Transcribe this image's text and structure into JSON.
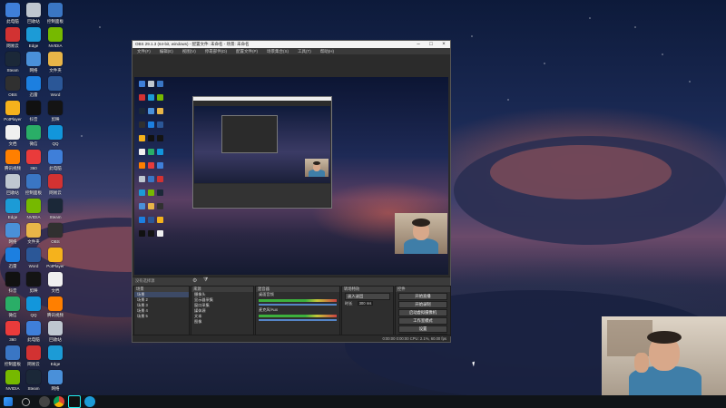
{
  "desktop": {
    "icons": [
      {
        "label": "此电脑",
        "color": "#3f7fd9",
        "icon": "computer-icon"
      },
      {
        "label": "回收站",
        "color": "#bfc7d0",
        "icon": "recycle-bin-icon"
      },
      {
        "label": "控制面板",
        "color": "#3a76c4",
        "icon": "control-panel-icon"
      },
      {
        "label": "网易云",
        "color": "#d23232",
        "icon": "netease-music-icon"
      },
      {
        "label": "Edge",
        "color": "#1c9bd6",
        "icon": "edge-icon"
      },
      {
        "label": "NVIDIA",
        "color": "#76b900",
        "icon": "nvidia-icon"
      },
      {
        "label": "Steam",
        "color": "#1b2838",
        "icon": "steam-icon"
      },
      {
        "label": "网络",
        "color": "#4a90d9",
        "icon": "network-icon"
      },
      {
        "label": "文件夹",
        "color": "#e8b548",
        "icon": "folder-icon"
      },
      {
        "label": "OBS",
        "color": "#303030",
        "icon": "obs-icon"
      },
      {
        "label": "迅雷",
        "color": "#1c7fe0",
        "icon": "thunder-icon"
      },
      {
        "label": "Word",
        "color": "#2b5797",
        "icon": "word-icon"
      },
      {
        "label": "PotPlayer",
        "color": "#f5b21c",
        "icon": "potplayer-icon"
      },
      {
        "label": "抖音",
        "color": "#111111",
        "icon": "douyin-icon"
      },
      {
        "label": "剪映",
        "color": "#141414",
        "icon": "capcut-icon"
      },
      {
        "label": "文档",
        "color": "#f0f0f0",
        "icon": "document-icon"
      },
      {
        "label": "微信",
        "color": "#2aae67",
        "icon": "wechat-icon"
      },
      {
        "label": "QQ",
        "color": "#1296db",
        "icon": "qq-icon"
      },
      {
        "label": "腾讯视频",
        "color": "#ff7f00",
        "icon": "tencent-video-icon"
      },
      {
        "label": "360",
        "color": "#e93b3b",
        "icon": "360-icon"
      }
    ]
  },
  "taskbar": {
    "items": [
      "start-icon",
      "search-icon",
      "obs-icon",
      "chrome-icon",
      "douyin-icon",
      "edge-icon"
    ]
  },
  "obs": {
    "title": "OBS 29.1.3 (64-bit, windows) - 配置文件: 未命名 - 场景: 未命名",
    "menu": [
      "文件(F)",
      "编辑(E)",
      "视图(V)",
      "停靠部件(D)",
      "配置文件(P)",
      "场景集合(S)",
      "工具(T)",
      "帮助(H)"
    ],
    "toolbar_label": "没有选择源",
    "docks": {
      "scenes": {
        "title": "场景",
        "items": [
          "场景",
          "场景 2",
          "场景 3",
          "场景 4",
          "场景 5"
        ]
      },
      "sources": {
        "title": "来源",
        "items": [
          "摄像头",
          "显示器采集",
          "窗口采集",
          "媒体源",
          "文本",
          "图像"
        ]
      },
      "mixer": {
        "title": "混音器",
        "items": [
          {
            "name": "桌面音频",
            "db": "0.0 dB"
          },
          {
            "name": "麦克风/Aux",
            "db": "0.0 dB"
          }
        ]
      },
      "transitions": {
        "title": "转场特效",
        "type": "淡入淡出",
        "duration_label": "时长",
        "duration": "300 ms"
      },
      "controls": {
        "title": "控件",
        "buttons": [
          "开始直播",
          "开始录制",
          "启动虚拟摄像机",
          "工作室模式",
          "设置",
          "退出"
        ]
      }
    },
    "status": "0:00:00  0:00:00  CPU: 2.1%, 60.00 fps"
  }
}
